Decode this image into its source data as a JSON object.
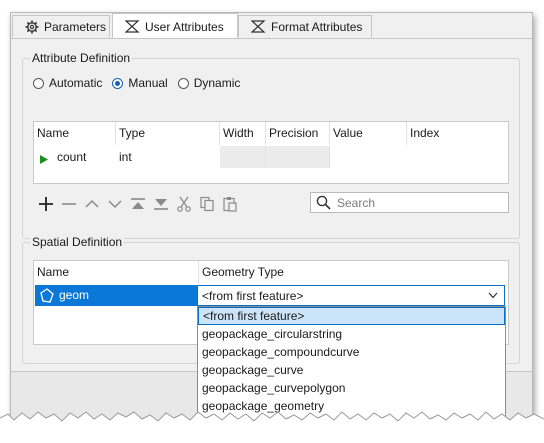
{
  "tabs": [
    {
      "label": "Parameters",
      "icon": "gear-icon",
      "active": false
    },
    {
      "label": "User Attributes",
      "icon": "sigma-icon",
      "active": true
    },
    {
      "label": "Format Attributes",
      "icon": "sigma-icon",
      "active": false
    }
  ],
  "attribute_definition": {
    "title": "Attribute Definition",
    "modes": [
      "Automatic",
      "Manual",
      "Dynamic"
    ],
    "selected_mode": "Manual"
  },
  "attribute_table": {
    "columns": [
      "Name",
      "Type",
      "Width",
      "Precision",
      "Value",
      "Index"
    ],
    "rows": [
      {
        "name": "count",
        "type": "int",
        "width": "",
        "precision": "",
        "value": "",
        "index": ""
      }
    ]
  },
  "toolbar": {
    "icons": [
      "add-icon",
      "remove-icon",
      "move-up-icon",
      "move-down-icon",
      "move-top-icon",
      "move-bottom-icon",
      "cut-icon",
      "copy-icon",
      "paste-icon"
    ],
    "search_placeholder": "Search"
  },
  "spatial_definition": {
    "title": "Spatial Definition",
    "columns": [
      "Name",
      "Geometry Type"
    ],
    "rows": [
      {
        "name": "geom",
        "geometry_type": "<from first feature>"
      }
    ]
  },
  "geometry_dropdown": {
    "options": [
      "<from first feature>",
      "geopackage_circularstring",
      "geopackage_compoundcurve",
      "geopackage_curve",
      "geopackage_curvepolygon",
      "geopackage_geometry"
    ],
    "selected": "<from first feature>"
  },
  "colors": {
    "accent": "#0a78d7",
    "highlight": "#cce4f7",
    "run_arrow": "#1e8c1e"
  }
}
